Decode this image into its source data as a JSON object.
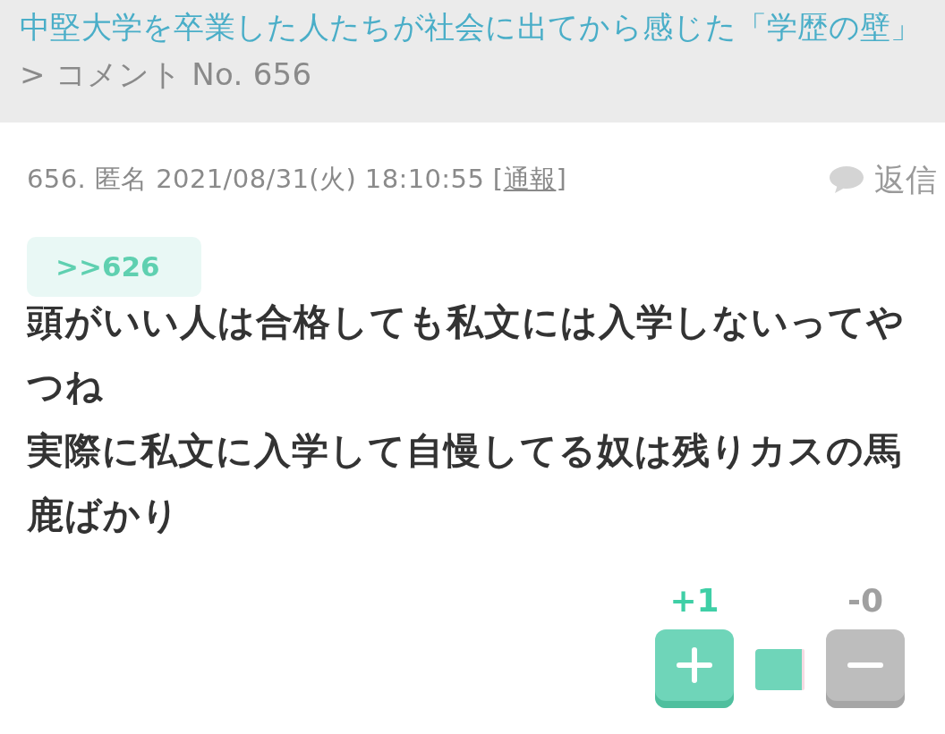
{
  "breadcrumb": {
    "title": "中堅大学を卒業した人たちが社会に出てから感じた「学歴の壁」",
    "current": "> コメント No. 656"
  },
  "comment": {
    "meta": {
      "text_before": "656. 匿名 2021/08/31(火) 18:10:55 [",
      "report_link": "通報",
      "text_after": "]"
    },
    "reply": "返信",
    "anchor": ">>626",
    "body_lines": [
      "頭がいい人は合格しても私文には入学しないってやつね",
      "実際に私文に入学して自慢してる奴は残りカスの馬鹿ばかり"
    ],
    "votes": {
      "plus_count": "+1",
      "minus_count": "-0",
      "level": 1
    }
  }
}
